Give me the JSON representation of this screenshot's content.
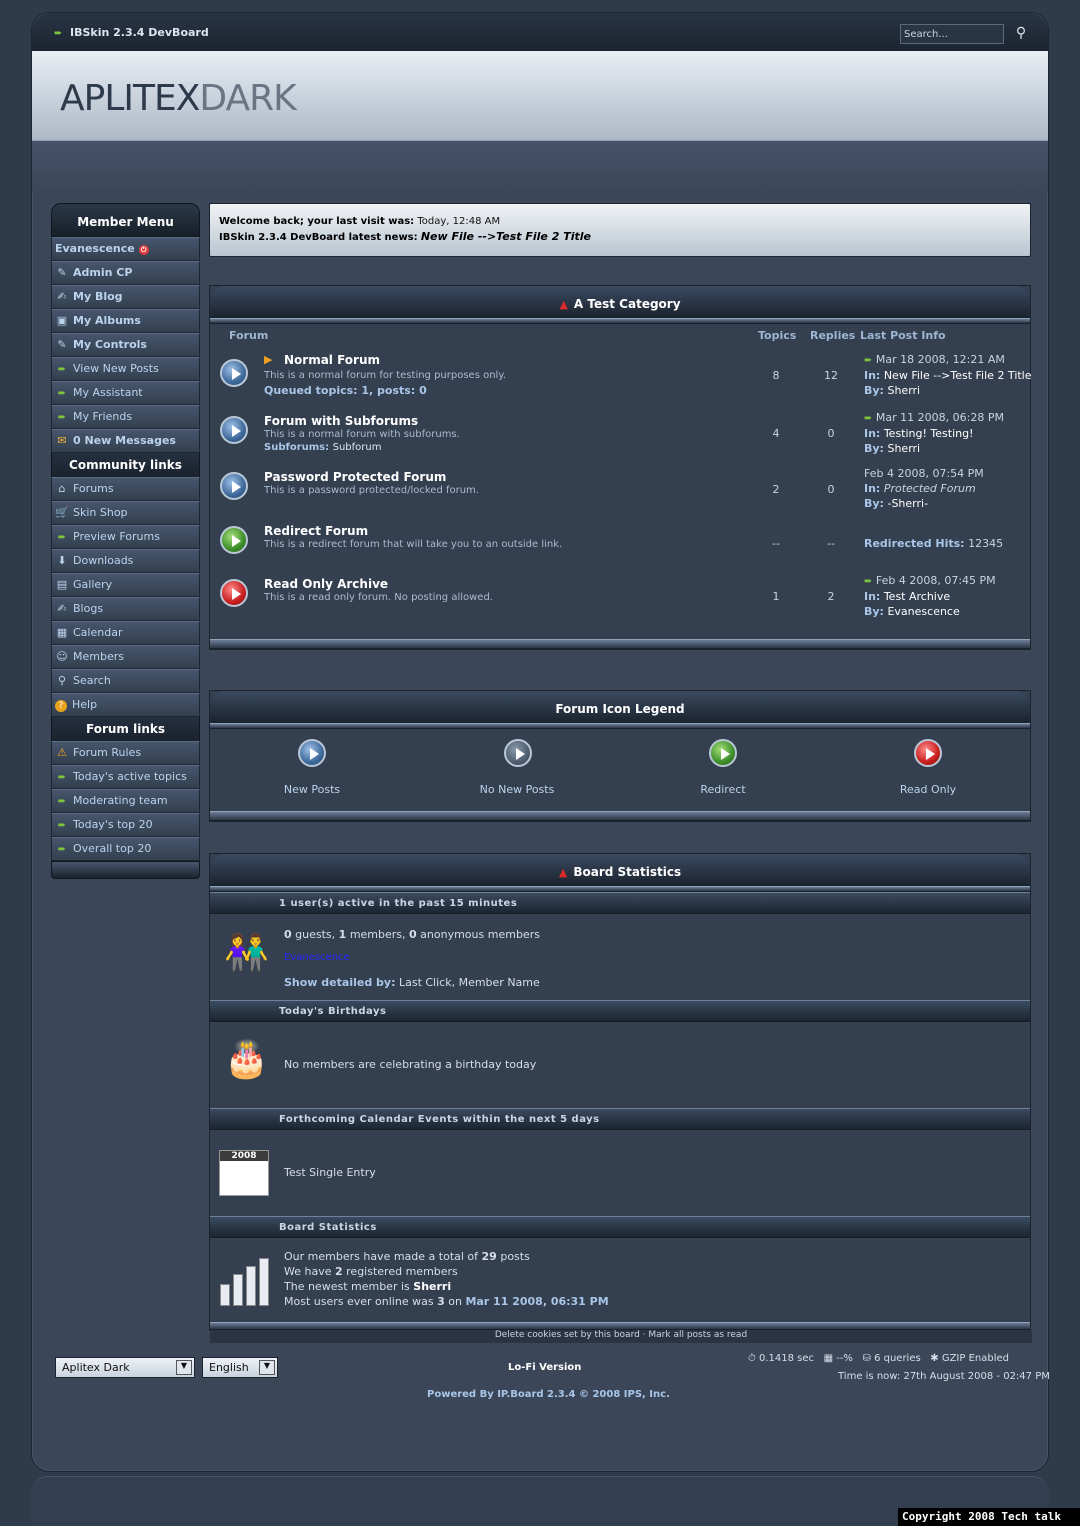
{
  "header": {
    "title": "IBSkin 2.3.4 DevBoard",
    "search_placeholder": "Search...",
    "logo_bold": "APLITEX",
    "logo_light": "DARK"
  },
  "sidebar": {
    "member_menu_title": "Member Menu",
    "user": "Evanescence",
    "member_items": [
      {
        "label": "Admin CP",
        "icon": "tools-icon"
      },
      {
        "label": "My Blog",
        "icon": "blog-icon"
      },
      {
        "label": "My Albums",
        "icon": "albums-icon"
      },
      {
        "label": "My Controls",
        "icon": "tools-icon"
      },
      {
        "label": "View New Posts",
        "icon": "arrow-icon"
      },
      {
        "label": "My Assistant",
        "icon": "arrow-icon"
      },
      {
        "label": "My Friends",
        "icon": "arrow-icon"
      },
      {
        "label": "0 New Messages",
        "icon": "envelope-icon"
      }
    ],
    "community_title": "Community links",
    "community_items": [
      {
        "label": "Forums",
        "icon": "home-icon"
      },
      {
        "label": "Skin Shop",
        "icon": "cart-icon"
      },
      {
        "label": "Preview Forums",
        "icon": "arrow-icon"
      },
      {
        "label": "Downloads",
        "icon": "download-icon"
      },
      {
        "label": "Gallery",
        "icon": "gallery-icon"
      },
      {
        "label": "Blogs",
        "icon": "blog-icon"
      },
      {
        "label": "Calendar",
        "icon": "calendar-icon"
      },
      {
        "label": "Members",
        "icon": "members-icon"
      },
      {
        "label": "Search",
        "icon": "search-icon"
      },
      {
        "label": "Help",
        "icon": "help-icon"
      }
    ],
    "forum_links_title": "Forum links",
    "forum_links": [
      {
        "label": "Forum Rules",
        "icon": "warning-icon"
      },
      {
        "label": "Today's active topics",
        "icon": "arrow-icon"
      },
      {
        "label": "Moderating team",
        "icon": "arrow-icon"
      },
      {
        "label": "Today's top 20",
        "icon": "arrow-icon"
      },
      {
        "label": "Overall top 20",
        "icon": "arrow-icon"
      }
    ]
  },
  "welcome": {
    "line1_label": "Welcome back; your last visit was:",
    "line1_value": "Today, 12:48 AM",
    "line2_label": "IBSkin 2.3.4 DevBoard latest news:",
    "line2_value": "New File -->Test File 2 Title"
  },
  "category": {
    "title": "A Test Category",
    "columns": [
      "Forum",
      "Topics",
      "Replies",
      "Last Post Info"
    ],
    "forums": [
      {
        "name": "Normal Forum",
        "desc": "This is a normal forum for testing purposes only.",
        "extra_label": "Queued topics: 1, posts: 0",
        "extra_value": "",
        "topics": "8",
        "replies": "12",
        "lp_date": "Mar 18 2008, 12:21 AM",
        "lp_in": "New File -->Test File 2 Title",
        "lp_by": "Sherri",
        "status": "new"
      },
      {
        "name": "Forum with Subforums",
        "desc": "This is a normal forum with subforums.",
        "extra_label": "Subforums:",
        "extra_value": "Subforum",
        "topics": "4",
        "replies": "0",
        "lp_date": "Mar 11 2008, 06:28 PM",
        "lp_in": "Testing! Testing!",
        "lp_by": "Sherri",
        "status": "new"
      },
      {
        "name": "Password Protected Forum",
        "desc": "This is a password protected/locked forum.",
        "extra_label": "",
        "extra_value": "",
        "topics": "2",
        "replies": "0",
        "lp_date": "Feb 4 2008, 07:54 PM",
        "lp_in": "Protected Forum",
        "lp_by": "-Sherri-",
        "status": "new"
      },
      {
        "name": "Redirect Forum",
        "desc": "This is a redirect forum that will take you to an outside link.",
        "extra_label": "",
        "extra_value": "",
        "topics": "--",
        "replies": "--",
        "lp_label": "Redirected Hits:",
        "lp_hits": "12345",
        "status": "redirect"
      },
      {
        "name": "Read Only Archive",
        "desc": "This is a read only forum. No posting allowed.",
        "extra_label": "",
        "extra_value": "",
        "topics": "1",
        "replies": "2",
        "lp_date": "Feb 4 2008, 07:45 PM",
        "lp_in": "Test Archive",
        "lp_by": "Evanescence",
        "status": "readonly"
      }
    ],
    "in_label": "In:",
    "by_label": "By:"
  },
  "legend": {
    "title": "Forum Icon Legend",
    "items": [
      "New Posts",
      "No New Posts",
      "Redirect",
      "Read Only"
    ]
  },
  "stats": {
    "title": "Board Statistics",
    "active_head": "1 user(s) active in the past 15 minutes",
    "guests": "0",
    "guests_label": "guests,",
    "members": "1",
    "members_label": "members,",
    "anon": "0",
    "anon_label": "anonymous members",
    "active_user": "Evanescence",
    "detail_label": "Show detailed by:",
    "detail_value": "Last Click, Member Name",
    "birthday_head": "Today's Birthdays",
    "birthday_text": "No members are celebrating a birthday today",
    "calendar_head": "Forthcoming Calendar Events within the next 5 days",
    "calendar_year": "2008",
    "calendar_text": "Test Single Entry",
    "board_head": "Board Statistics",
    "posts_pre": "Our members have made a total of",
    "posts_count": "29",
    "posts_post": "posts",
    "reg_pre": "We have",
    "reg_count": "2",
    "reg_post": "registered members",
    "newest_pre": "The newest member is",
    "newest_name": "Sherri",
    "most_pre": "Most users ever online was",
    "most_count": "3",
    "most_on": "on",
    "most_date": "Mar 11 2008, 06:31 PM",
    "footer_links": "Delete cookies set by this board · Mark all posts as read"
  },
  "footer": {
    "skin_select": "Aplitex Dark",
    "lang_select": "English",
    "lofi": "Lo-Fi Version",
    "powered": "Powered By IP.Board 2.3.4 © 2008  IPS, Inc.",
    "exec_time": "0.1418 sec",
    "load": "--%",
    "queries": "6 queries",
    "gzip": "GZIP Enabled",
    "time_now": "Time is now: 27th August 2008 - 02:47 PM",
    "copyright": "Copyright 2008 Tech talk"
  }
}
